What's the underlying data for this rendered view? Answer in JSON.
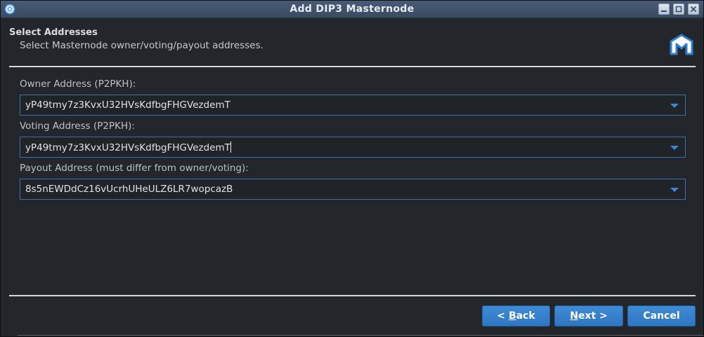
{
  "window": {
    "title": "Add DIP3 Masternode",
    "controls": [
      "minimize",
      "maximize",
      "close"
    ]
  },
  "header": {
    "title": "Select Addresses",
    "subtitle": "Select Masternode owner/voting/payout addresses."
  },
  "fields": [
    {
      "label": "Owner Address (P2PKH):",
      "value": "yP49tmy7z3KvxU32HVsKdfbgFHGVezdemT"
    },
    {
      "label": "Voting Address (P2PKH):",
      "value": "yP49tmy7z3KvxU32HVsKdfbgFHGVezdemT"
    },
    {
      "label": "Payout Address (must differ from owner/voting):",
      "value": "8s5nEWDdCz16vUcrhUHeULZ6LR7wopcazB"
    }
  ],
  "buttons": {
    "back_prefix": "< ",
    "back_mnemonic": "B",
    "back_rest": "ack",
    "next_mnemonic": "N",
    "next_rest": "ext >",
    "cancel": "Cancel"
  },
  "colors": {
    "accent": "#3a84d0",
    "field_border": "#3d6fb3",
    "background": "#23262b",
    "titlebar": "#425370"
  },
  "icons": {
    "app": "electrum-dash-icon",
    "logo": "dash-masternode-logo",
    "dropdown": "chevron-down-icon"
  }
}
